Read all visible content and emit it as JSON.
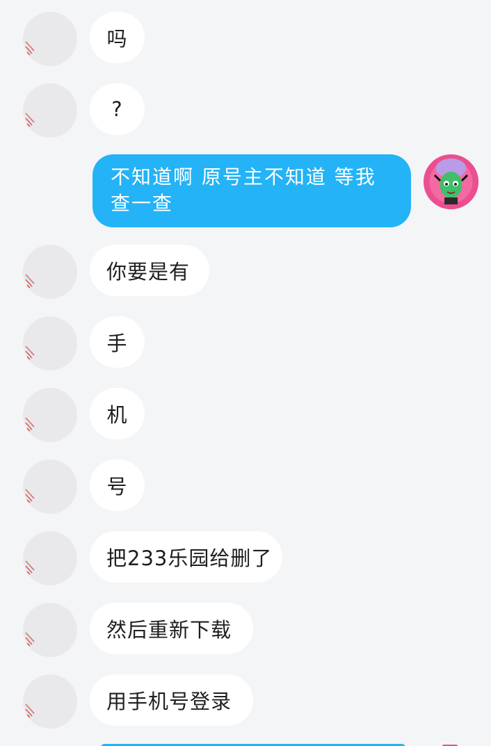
{
  "colors": {
    "background": "#f4f5f7",
    "incoming_bubble": "#ffffff",
    "outgoing_bubble": "#23b3f6",
    "avatar_placeholder": "#e9e9eb"
  },
  "messages": [
    {
      "sender": "other",
      "text": "吗"
    },
    {
      "sender": "other",
      "text": "?"
    },
    {
      "sender": "me",
      "text": "不知道啊 原号主不知道 等我查一查"
    },
    {
      "sender": "other",
      "text": "你要是有"
    },
    {
      "sender": "other",
      "text": "手"
    },
    {
      "sender": "other",
      "text": "机"
    },
    {
      "sender": "other",
      "text": "号"
    },
    {
      "sender": "other",
      "text": "把233乐园给删了"
    },
    {
      "sender": "other",
      "text": "然后重新下载"
    },
    {
      "sender": "other",
      "text": "用手机号登录"
    }
  ],
  "icons": {
    "other_avatar": "user-avatar-placeholder-icon",
    "my_avatar": "cartoon-character-avatar-icon"
  }
}
